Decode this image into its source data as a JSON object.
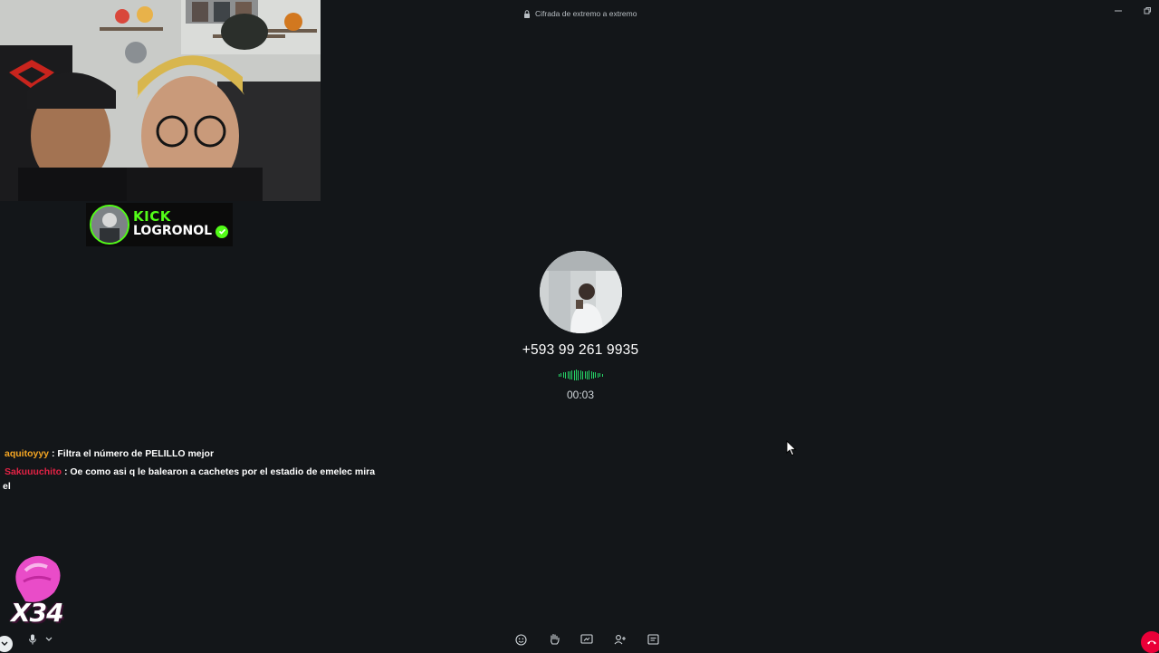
{
  "window": {
    "title": "Cifrada de extremo a extremo",
    "icons": {
      "lock": "lock-icon",
      "minimize": "minimize-icon",
      "restore": "restore-icon"
    }
  },
  "overlay": {
    "kick_brand": "KICK",
    "kick_username": "LOGRONOL",
    "combo_count": "X34"
  },
  "call": {
    "phone_number": "+593 99 261 9935",
    "timer": "00:03",
    "waveform_color": "#25d366"
  },
  "chat": [
    {
      "user": "aquitoyyy",
      "separator": ":",
      "message": "Filtra el número de PELILLO mejor",
      "user_color": "#f5a623"
    },
    {
      "user": "Sakuuuchito",
      "separator": ":",
      "message": "Oe como asi q le balearon a cachetes por el estadio de emelec mira",
      "continuation": "el",
      "user_color": "#e32245"
    }
  ],
  "toolbar": {
    "items": [
      "chevron-down-icon",
      "microphone-icon",
      "emoji-icon",
      "raise-hand-icon",
      "share-screen-icon",
      "add-participant-icon",
      "chat-panel-icon",
      "end-call-icon"
    ]
  },
  "colors": {
    "background": "#131619",
    "kick_green": "#53fc18",
    "end_call": "#ea0038"
  }
}
